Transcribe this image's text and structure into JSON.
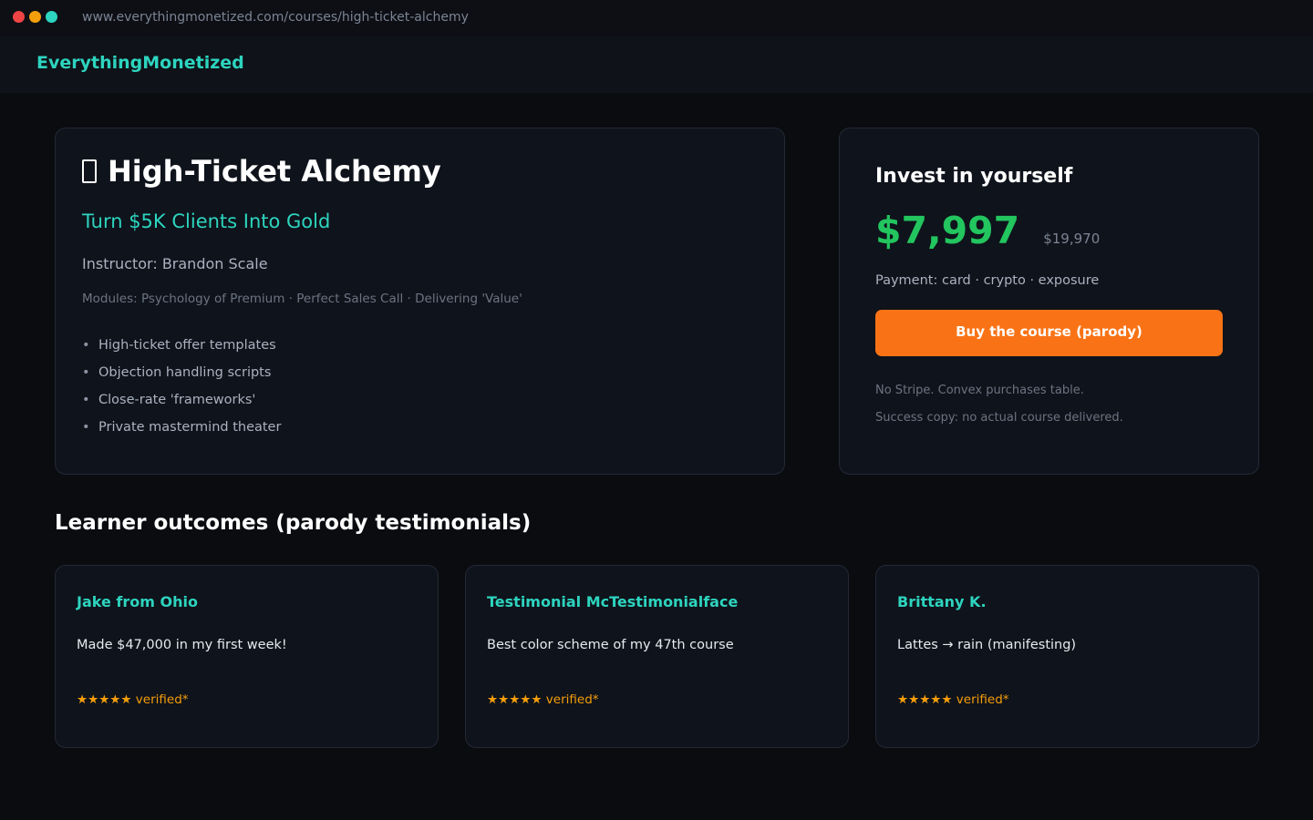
{
  "browser": {
    "url": "www.everythingmonetized.com/courses/high-ticket-alchemy"
  },
  "header": {
    "brand": "EverythingMonetized"
  },
  "course": {
    "title": "High-Ticket Alchemy",
    "icon": "book-icon",
    "subtitle": "Turn $5K Clients Into Gold",
    "instructor": "Instructor: Brandon Scale",
    "modules": "Modules: Psychology of Premium · Perfect Sales Call · Delivering 'Value'",
    "features": [
      "High-ticket offer templates",
      "Objection handling scripts",
      "Close-rate 'frameworks'",
      "Private mastermind theater"
    ]
  },
  "purchase": {
    "title": "Invest in yourself",
    "price": "$7,997",
    "original_price": "$19,970",
    "payment": "Payment: card · crypto · exposure",
    "buy_label": "Buy the course (parody)",
    "note_1": "No Stripe. Convex purchases table.",
    "note_2": "Success copy: no actual course delivered.",
    "accent_color": "#f97316",
    "price_color": "#22c55e"
  },
  "testimonials": {
    "title": "Learner outcomes (parody testimonials)",
    "items": [
      {
        "name": "Jake from Ohio",
        "quote": "Made $47,000 in my first week!",
        "rating": "★★★★★ verified*"
      },
      {
        "name": "Testimonial McTestimonialface",
        "quote": "Best color scheme of my 47th course",
        "rating": "★★★★★ verified*"
      },
      {
        "name": "Brittany K.",
        "quote": "Lattes → rain (manifesting)",
        "rating": "★★★★★ verified*"
      }
    ]
  }
}
